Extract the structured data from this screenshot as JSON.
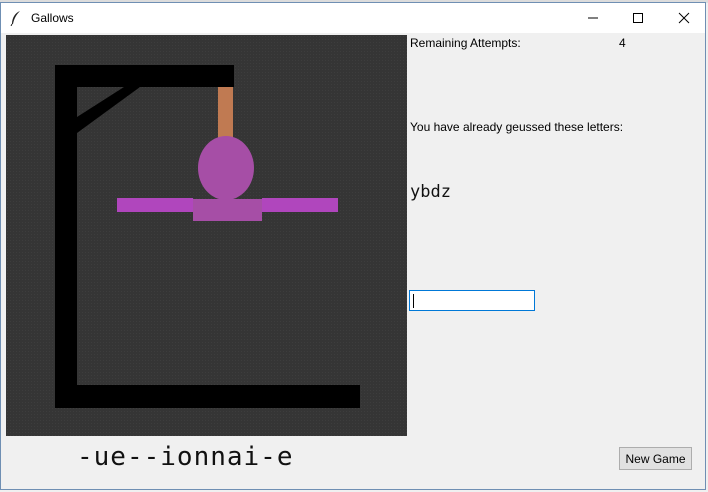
{
  "window": {
    "title": "Gallows",
    "icon": "feather-icon",
    "controls": [
      "minimize-icon",
      "maximize-icon",
      "close-icon"
    ]
  },
  "game": {
    "remaining_label": "Remaining Attempts:",
    "remaining_count": "4",
    "guessed_label": "You have already geussed these letters:",
    "guessed_letters": "ybdz",
    "word_display": "-ue--ionnai-e",
    "guess_input_value": "",
    "new_game_label": "New Game"
  },
  "colors": {
    "canvas_bg": "#353535",
    "gallows": "#000000",
    "rope": "#c07a52",
    "body": "#a64ea6",
    "arms": "#b046bd",
    "input_focus_border": "#0078d7"
  }
}
